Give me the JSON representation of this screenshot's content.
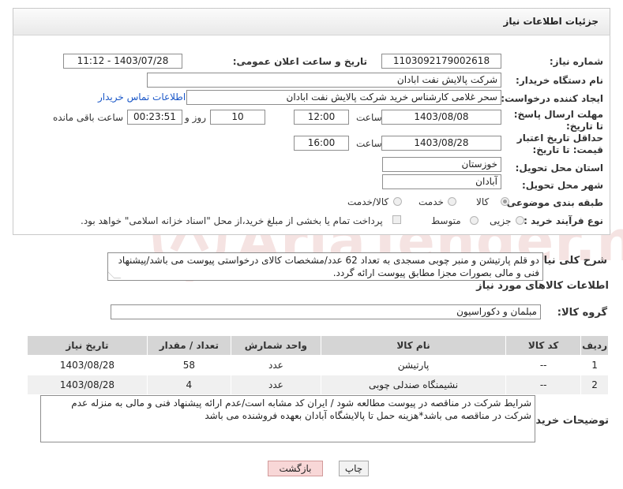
{
  "header": {
    "title": "جزئیات اطلاعات نیاز"
  },
  "form": {
    "need_number": {
      "label": "شماره نیاز:",
      "value": "1103092179002618"
    },
    "announce_datetime": {
      "label": "تاریخ و ساعت اعلان عمومی:",
      "value": "1403/07/28 - 11:12"
    },
    "buyer_org": {
      "label": "نام دستگاه خریدار:",
      "value": "شرکت پالایش نفت ابادان"
    },
    "requester": {
      "label": "ایجاد کننده درخواست:",
      "value": "سحر غلامی کارشناس خرید  شرکت پالایش نفت ابادان",
      "contact_link": "اطلاعات تماس خریدار"
    },
    "reply_deadline": {
      "label": "مهلت ارسال پاسخ: تا تاریخ:",
      "date": "1403/08/08",
      "time_label": "ساعت",
      "time": "12:00",
      "days": "10",
      "days_label": "روز و",
      "remaining": "00:23:51",
      "remaining_label": "ساعت باقی مانده"
    },
    "price_validity": {
      "label": "حداقل تاریخ اعتبار قیمت: تا تاریخ:",
      "date": "1403/08/28",
      "time_label": "ساعت",
      "time": "16:00"
    },
    "province": {
      "label": "استان محل تحویل:",
      "value": "خوزستان"
    },
    "city": {
      "label": "شهر محل تحویل:",
      "value": "آبادان"
    },
    "category": {
      "label": "طبقه بندی موضوعی:",
      "options": [
        "کالا",
        "خدمت",
        "کالا/خدمت"
      ],
      "selected": "کالا"
    },
    "purchase_process": {
      "label": "نوع فرآیند خرید :",
      "options": [
        "جزیی",
        "متوسط"
      ],
      "selected": "",
      "payment_note": "پرداخت تمام یا بخشی از مبلغ خرید،از محل \"اسناد خزانه اسلامی\" خواهد بود."
    }
  },
  "description": {
    "label": "شرح کلی نیاز:",
    "text": "دو قلم پارتیشن و منبر چوبی مسجدی به تعداد 62 عدد/مشخصات کالای درخواستی پیوست می باشد/پیشنهاد فنی و مالی بصورات مجزا مطابق پیوست ارائه گردد."
  },
  "goods_section": {
    "title": "اطلاعات کالاهای مورد نیاز",
    "group_label": "گروه کالا:",
    "group_value": "مبلمان و دکوراسیون",
    "columns": [
      "ردیف",
      "کد کالا",
      "نام کالا",
      "واحد شمارش",
      "تعداد / مقدار",
      "تاریخ نیاز"
    ],
    "rows": [
      [
        "1",
        "--",
        "پارتیشن",
        "عدد",
        "58",
        "1403/08/28"
      ],
      [
        "2",
        "--",
        "نشیمنگاه صندلی چوبی",
        "عدد",
        "4",
        "1403/08/28"
      ]
    ]
  },
  "buyer_notes": {
    "label": "توضیحات خریدار:",
    "text": "شرایط شرکت در مناقصه در پیوست مطالعه شود / ایران کد مشابه است/عدم ارائه پیشنهاد فنی و مالی به منزله عدم شرکت در مناقصه می باشد*هزینه حمل تا پالایشگاه آبادان بعهده فروشنده می باشد"
  },
  "buttons": {
    "print": "چاپ",
    "back": "بازگشت"
  },
  "watermark": {
    "text": "AriaTender.neT"
  }
}
